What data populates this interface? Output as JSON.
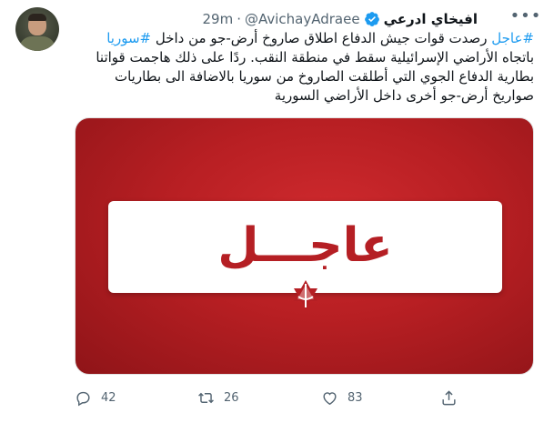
{
  "tweet": {
    "author_name": "افيخاي ادرعي",
    "handle": "@AvichayAdraee",
    "separator": "·",
    "time": "29m",
    "more_label": "•••",
    "text_segments": [
      {
        "text": "#عاجل",
        "hashtag": true
      },
      {
        "text": " رصدت قوات جيش الدفاع اطلاق صاروخ أرض-جو من داخل ",
        "hashtag": false
      },
      {
        "text": "#سوريا",
        "hashtag": true
      },
      {
        "text": " باتجاه الأراضي الإسرائيلية سقط في منطقة النقب. ردًا على ذلك هاجمت قواتنا بطارية الدفاع الجوي التي أطلقت الصاروخ من سوريا بالاضافة الى بطاريات صواريخ أرض-جو أخرى داخل الأراضي السورية",
        "hashtag": false
      }
    ],
    "media": {
      "banner_text": "عاجـــل",
      "background_color": "#b81f23",
      "accent_color": "#b51f24"
    },
    "actions": {
      "reply_count": "42",
      "retweet_count": "26",
      "like_count": "83"
    },
    "colors": {
      "link": "#1d9bf0",
      "secondary_text": "#536471",
      "verified": "#1d9bf0"
    }
  }
}
